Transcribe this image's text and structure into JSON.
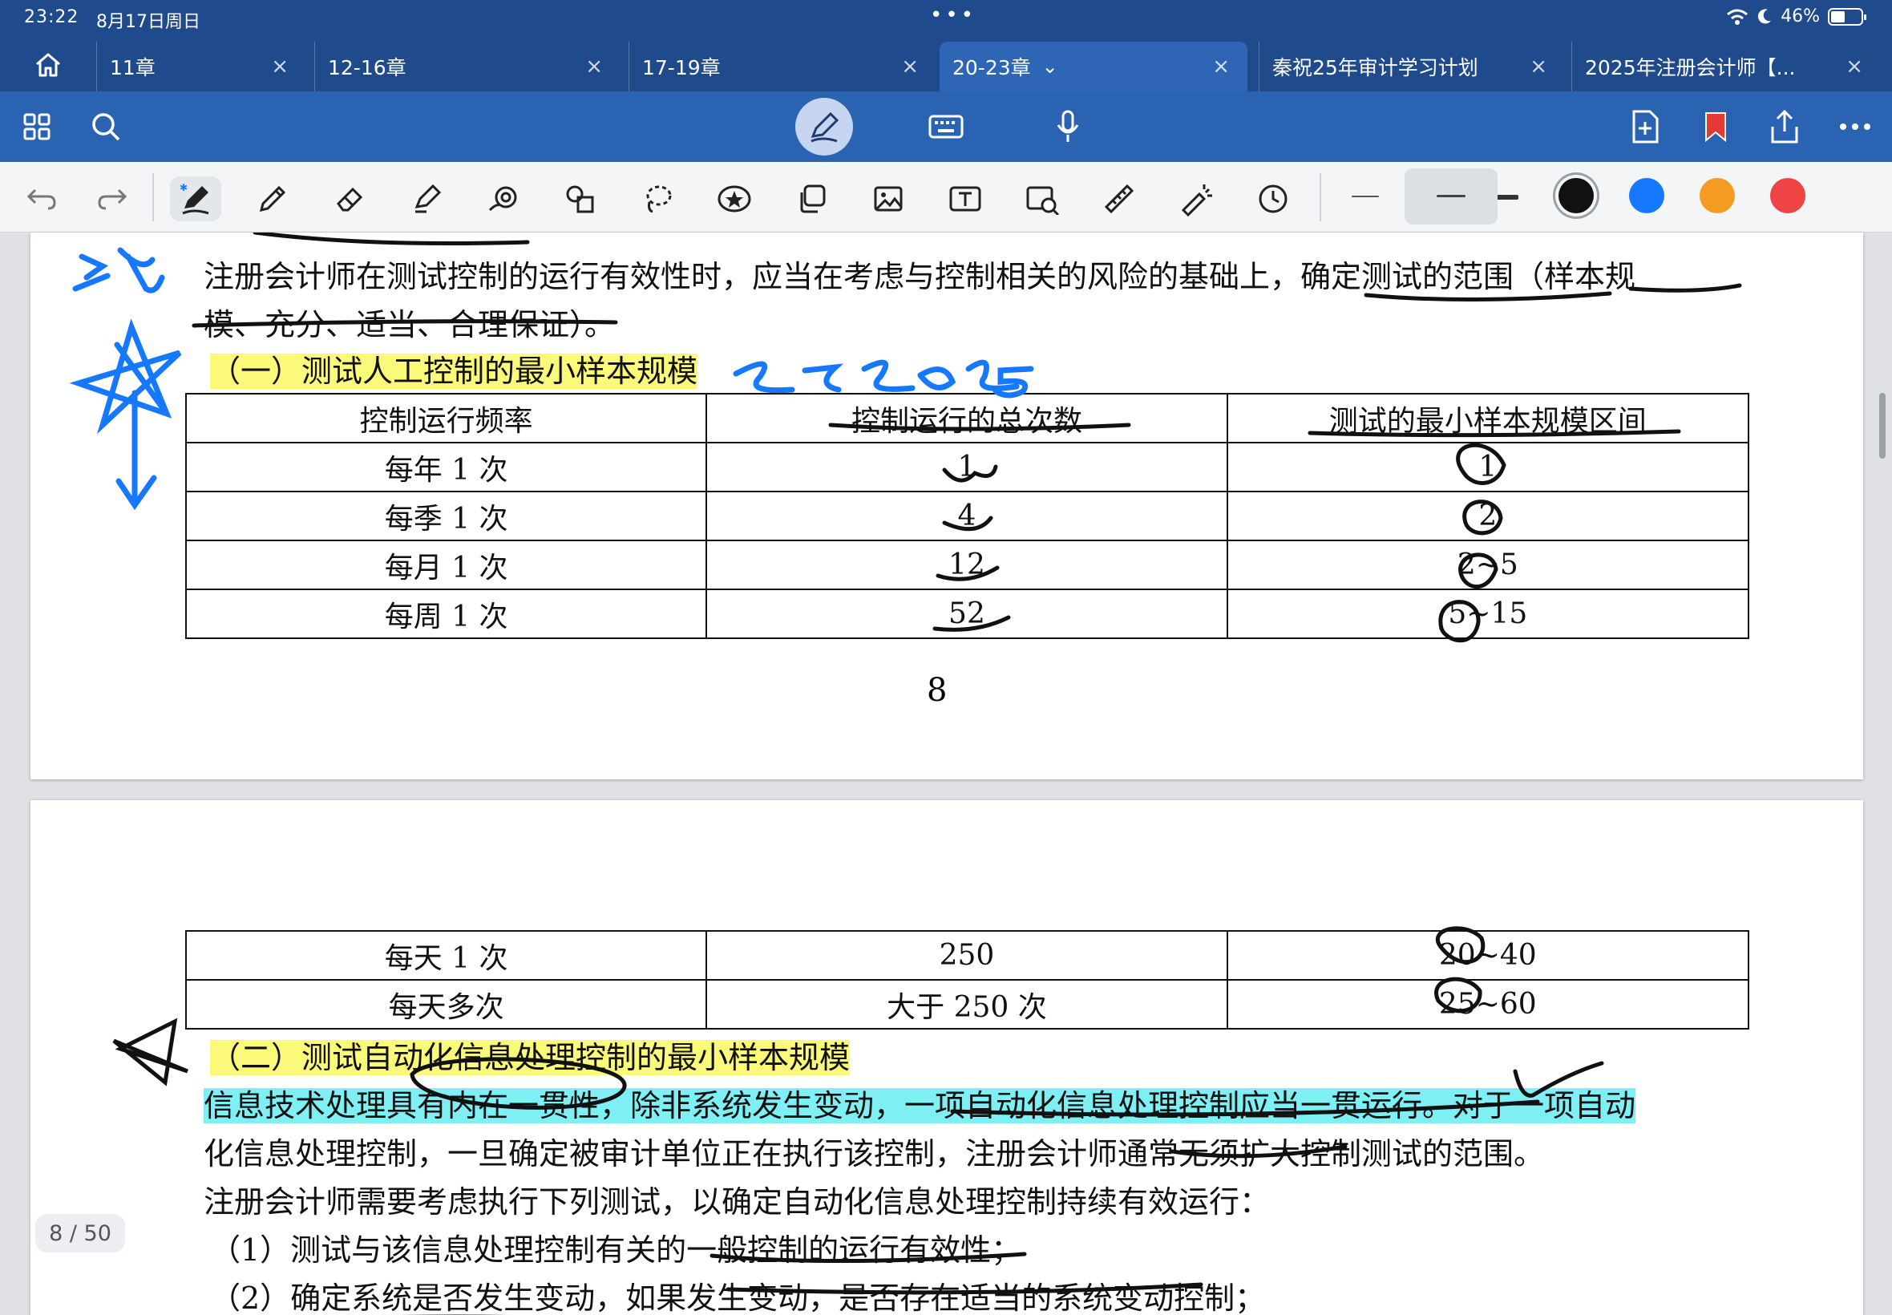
{
  "status": {
    "time": "23:22",
    "date": "8月17日周日",
    "battery": "46%",
    "battery_level": 0.46
  },
  "tabs": [
    {
      "label": "11章"
    },
    {
      "label": "12-16章"
    },
    {
      "label": "17-19章"
    },
    {
      "label": "20-23章",
      "active": true
    },
    {
      "label": "秦祝25年审计学习计划"
    },
    {
      "label": "2025年注册会计师【..."
    }
  ],
  "tab_close_glyph": "×",
  "active_tab_chevron": "⌄",
  "toolbar": {
    "pen_colors": [
      "#111111",
      "#1677ff",
      "#f59a23",
      "#ef4444"
    ],
    "selected_color": "#111111",
    "icons": [
      "undo-icon",
      "redo-icon",
      "pen-icon",
      "pencil-icon",
      "eraser-icon",
      "highlighter-icon",
      "lasso-eraser-icon",
      "shapes-icon",
      "lasso-icon",
      "sticker-icon",
      "copy-icon",
      "image-icon",
      "text-box-icon",
      "camera-icon",
      "ruler-icon",
      "laser-pointer-icon",
      "timer-icon"
    ]
  },
  "page1": {
    "line1": "注册会计师在测试控制的运行有效性时，应当在考虑与控制相关的风险的基础上，确定测试的范围（样本规",
    "line2": "模、充分、适当、合理保证）。",
    "heading": "（一）测试人工控制的最小样本规模",
    "table_header": [
      "控制运行频率",
      "控制运行的总次数",
      "测试的最小样本规模区间"
    ],
    "table_rows": [
      [
        "每年 1 次",
        "1",
        "1"
      ],
      [
        "每季 1 次",
        "4",
        "2"
      ],
      [
        "每月 1 次",
        "12",
        "2~5"
      ],
      [
        "每周 1 次",
        "52",
        "5~15"
      ]
    ],
    "page_number": "8",
    "handwritten_note": "2252025",
    "margin_note": "记"
  },
  "page2": {
    "table_rows": [
      [
        "每天 1 次",
        "250",
        "20~40"
      ],
      [
        "每天多次",
        "大于 250 次",
        "25~60"
      ]
    ],
    "heading": "（二）测试自动化信息处理控制的最小样本规模",
    "para1_line1": "信息技术处理具有内在一贯性，除非系统发生变动，一项自动化信息处理控制应当一贯运行。对于一项自动",
    "para1_line2": "化信息处理控制，一旦确定被审计单位正在执行该控制，注册会计师通常无须扩大控制测试的范围。",
    "para2": "注册会计师需要考虑执行下列测试，以确定自动化信息处理控制持续有效运行：",
    "item1": "（1）测试与该信息处理控制有关的一般控制的运行有效性；",
    "item2": "（2）确定系统是否发生变动，如果发生变动，是否存在适当的系统变动控制；"
  },
  "page_indicator": "8 / 50"
}
